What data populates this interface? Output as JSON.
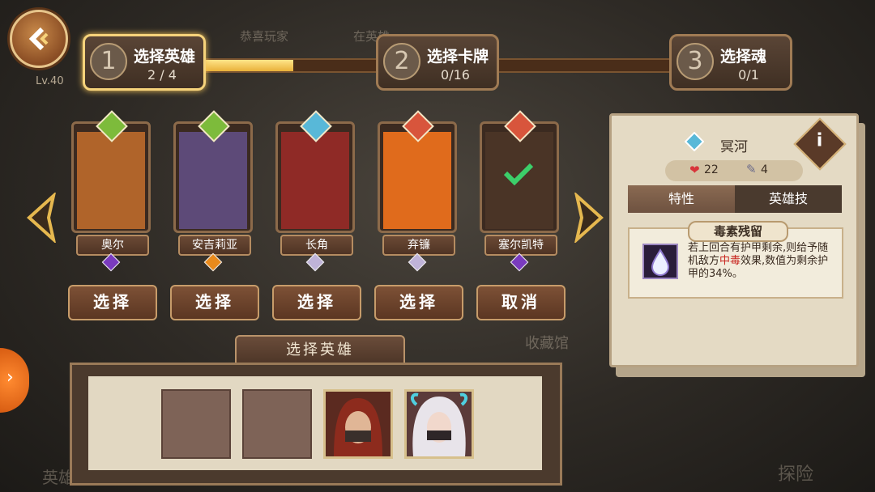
{
  "header": {
    "level": "Lv.40",
    "bg_texts": [
      "恭喜玩家",
      "在英雄"
    ],
    "steps": [
      {
        "num": "1",
        "title": "选择英雄",
        "count": "2 / 4"
      },
      {
        "num": "2",
        "title": "选择卡牌",
        "count": "0/16"
      },
      {
        "num": "3",
        "title": "选择魂",
        "count": "0/1"
      }
    ],
    "progress_fraction": 0.2
  },
  "heroes": [
    {
      "name": "奥尔",
      "button": "选择",
      "top_gem_color": "#7dbb3b",
      "bottom_gem_color": "#7a3bbf"
    },
    {
      "name": "安吉莉亚",
      "button": "选择",
      "top_gem_color": "#7dbb3b",
      "bottom_gem_color": "#e98a1c"
    },
    {
      "name": "长角",
      "button": "选择",
      "top_gem_color": "#58b8d8",
      "bottom_gem_color": "#bfb3d8"
    },
    {
      "name": "弃镰",
      "button": "选择",
      "top_gem_color": "#d8553c",
      "bottom_gem_color": "#bfb3d8"
    },
    {
      "name": "塞尔凯特",
      "button": "取消",
      "top_gem_color": "#d8553c",
      "bottom_gem_color": "#7a3bbf"
    }
  ],
  "background_labels": [
    "英雄",
    "收藏馆",
    "探险"
  ],
  "detail_panel": {
    "title": "冥河",
    "hp": "22",
    "cards": "4",
    "tabs": [
      "特性",
      "英雄技"
    ],
    "skill_name": "毒素残留",
    "skill_desc_before": "若上回合有护甲剩余,则给予随机敌方",
    "skill_desc_keyword": "中毒",
    "skill_desc_after": "效果,数值为剩余护甲的34%。"
  },
  "tray": {
    "title": "选择英雄"
  }
}
